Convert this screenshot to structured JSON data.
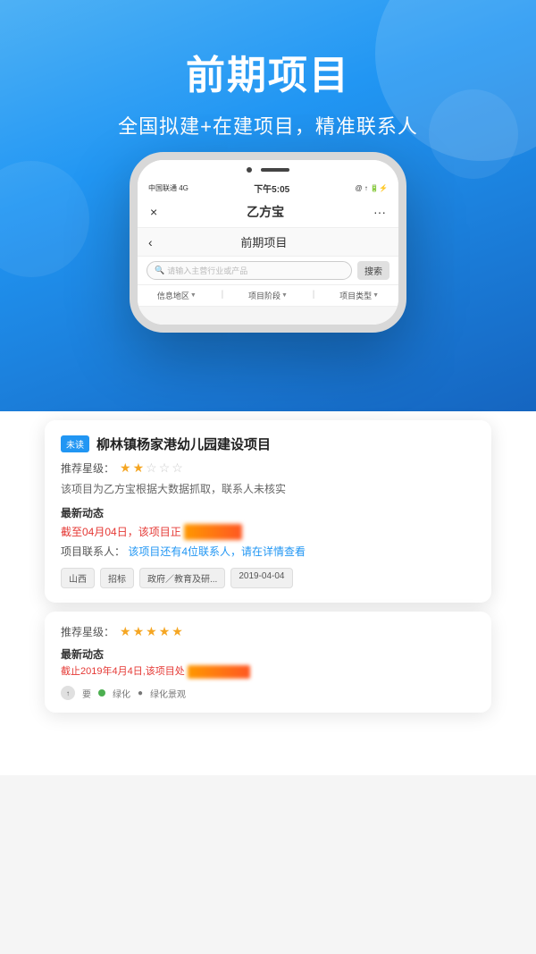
{
  "hero": {
    "main_title": "前期项目",
    "sub_title": "全国拟建+在建项目，精准联系人"
  },
  "phone": {
    "status_bar": {
      "carrier": "中国联通  4G",
      "time": "下午5:05",
      "icons": "@ ↑ ▮ ⚡"
    },
    "app_nav": {
      "close_icon": "×",
      "title": "乙方宝",
      "more_icon": "···"
    },
    "sub_nav": {
      "back_icon": "‹",
      "title": "前期项目"
    },
    "search": {
      "placeholder": "请输入主营行业或产品",
      "button_label": "搜索"
    },
    "filters": [
      {
        "label": "信息地区",
        "has_arrow": true
      },
      {
        "label": "项目阶段",
        "has_arrow": true
      },
      {
        "label": "项目类型",
        "has_arrow": true
      }
    ]
  },
  "cards": [
    {
      "unread_label": "未读",
      "title": "柳林镇杨家港幼儿园建设项目",
      "rating_label": "推荐星级：",
      "stars": 2,
      "total_stars": 5,
      "description": "该项目为乙方宝根据大数据抓取，联系人未核实",
      "dynamic_section_title": "最新动态",
      "dynamic_text_red": "截至04月04日，该项目正",
      "dynamic_blurred": "▓▓▓▓▓▓▓▓",
      "contact_label": "项目联系人：",
      "contact_link": "该项目还有4位联系人，请在详情查看",
      "tags": [
        "山西",
        "招标",
        "政府／教育及研...",
        "2019-04-04"
      ]
    }
  ],
  "card2": {
    "rating_label": "推荐星级：",
    "stars": 5,
    "total_stars": 5,
    "dynamic_section_title": "最新动态",
    "dynamic_text": "截止2019年4月4日,该项目处",
    "blurred_text": "▓▓▓▓▓▓▓▓▓▓▓▓▓",
    "footer_text1": "要",
    "footer_text2": "绿化",
    "footer_text3": "绿化景观"
  }
}
